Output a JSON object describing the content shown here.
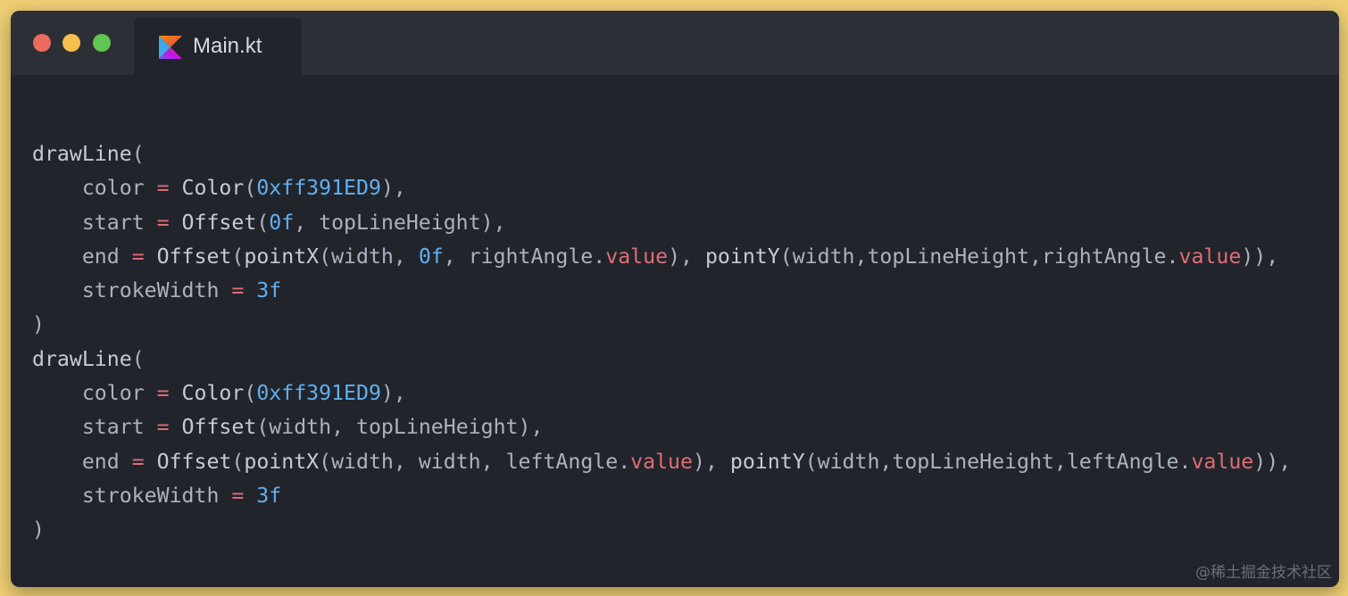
{
  "window": {
    "traffic_lights": [
      {
        "name": "close",
        "color": "#ed6a5e"
      },
      {
        "name": "minimize",
        "color": "#f5bf4f"
      },
      {
        "name": "zoom",
        "color": "#61c554"
      }
    ]
  },
  "tab": {
    "label": "Main.kt",
    "icon": "kotlin-icon"
  },
  "colors": {
    "plain": "#abb2bf",
    "identifier": "#c6cad3",
    "operator": "#e06c75",
    "number": "#61afef",
    "property": "#e06c75",
    "punct": "#abb2bf"
  },
  "code": {
    "lines": [
      [
        [
          "drawLine",
          "identifier"
        ],
        [
          "(",
          "punct"
        ]
      ],
      [
        [
          "    ",
          "plain"
        ],
        [
          "color",
          "plain"
        ],
        [
          " = ",
          "operator"
        ],
        [
          "Color",
          "identifier"
        ],
        [
          "(",
          "punct"
        ],
        [
          "0xff391ED9",
          "number"
        ],
        [
          ")",
          "punct"
        ],
        [
          ",",
          "punct"
        ]
      ],
      [
        [
          "    ",
          "plain"
        ],
        [
          "start",
          "plain"
        ],
        [
          " = ",
          "operator"
        ],
        [
          "Offset",
          "identifier"
        ],
        [
          "(",
          "punct"
        ],
        [
          "0f",
          "number"
        ],
        [
          ", ",
          "punct"
        ],
        [
          "topLineHeight",
          "plain"
        ],
        [
          ")",
          "punct"
        ],
        [
          ",",
          "punct"
        ]
      ],
      [
        [
          "    ",
          "plain"
        ],
        [
          "end",
          "plain"
        ],
        [
          " = ",
          "operator"
        ],
        [
          "Offset",
          "identifier"
        ],
        [
          "(",
          "punct"
        ],
        [
          "pointX",
          "identifier"
        ],
        [
          "(",
          "punct"
        ],
        [
          "width",
          "plain"
        ],
        [
          ", ",
          "punct"
        ],
        [
          "0f",
          "number"
        ],
        [
          ", ",
          "punct"
        ],
        [
          "rightAngle",
          "plain"
        ],
        [
          ".",
          "punct"
        ],
        [
          "value",
          "property"
        ],
        [
          ")",
          "punct"
        ],
        [
          ", ",
          "punct"
        ],
        [
          "pointY",
          "identifier"
        ],
        [
          "(",
          "punct"
        ],
        [
          "width",
          "plain"
        ],
        [
          ",",
          "punct"
        ],
        [
          "topLineHeight",
          "plain"
        ],
        [
          ",",
          "punct"
        ],
        [
          "rightAngle",
          "plain"
        ],
        [
          ".",
          "punct"
        ],
        [
          "value",
          "property"
        ],
        [
          "))",
          "punct"
        ],
        [
          ",",
          "punct"
        ]
      ],
      [
        [
          "    ",
          "plain"
        ],
        [
          "strokeWidth",
          "plain"
        ],
        [
          " = ",
          "operator"
        ],
        [
          "3f",
          "number"
        ]
      ],
      [
        [
          ")",
          "punct"
        ]
      ],
      [
        [
          "drawLine",
          "identifier"
        ],
        [
          "(",
          "punct"
        ]
      ],
      [
        [
          "    ",
          "plain"
        ],
        [
          "color",
          "plain"
        ],
        [
          " = ",
          "operator"
        ],
        [
          "Color",
          "identifier"
        ],
        [
          "(",
          "punct"
        ],
        [
          "0xff391ED9",
          "number"
        ],
        [
          ")",
          "punct"
        ],
        [
          ",",
          "punct"
        ]
      ],
      [
        [
          "    ",
          "plain"
        ],
        [
          "start",
          "plain"
        ],
        [
          " = ",
          "operator"
        ],
        [
          "Offset",
          "identifier"
        ],
        [
          "(",
          "punct"
        ],
        [
          "width",
          "plain"
        ],
        [
          ", ",
          "punct"
        ],
        [
          "topLineHeight",
          "plain"
        ],
        [
          ")",
          "punct"
        ],
        [
          ",",
          "punct"
        ]
      ],
      [
        [
          "    ",
          "plain"
        ],
        [
          "end",
          "plain"
        ],
        [
          " = ",
          "operator"
        ],
        [
          "Offset",
          "identifier"
        ],
        [
          "(",
          "punct"
        ],
        [
          "pointX",
          "identifier"
        ],
        [
          "(",
          "punct"
        ],
        [
          "width",
          "plain"
        ],
        [
          ", ",
          "punct"
        ],
        [
          "width",
          "plain"
        ],
        [
          ", ",
          "punct"
        ],
        [
          "leftAngle",
          "plain"
        ],
        [
          ".",
          "punct"
        ],
        [
          "value",
          "property"
        ],
        [
          ")",
          "punct"
        ],
        [
          ", ",
          "punct"
        ],
        [
          "pointY",
          "identifier"
        ],
        [
          "(",
          "punct"
        ],
        [
          "width",
          "plain"
        ],
        [
          ",",
          "punct"
        ],
        [
          "topLineHeight",
          "plain"
        ],
        [
          ",",
          "punct"
        ],
        [
          "leftAngle",
          "plain"
        ],
        [
          ".",
          "punct"
        ],
        [
          "value",
          "property"
        ],
        [
          "))",
          "punct"
        ],
        [
          ",",
          "punct"
        ]
      ],
      [
        [
          "    ",
          "plain"
        ],
        [
          "strokeWidth",
          "plain"
        ],
        [
          " = ",
          "operator"
        ],
        [
          "3f",
          "number"
        ]
      ],
      [
        [
          ")",
          "punct"
        ]
      ]
    ]
  },
  "watermark": "@稀土掘金技术社区"
}
